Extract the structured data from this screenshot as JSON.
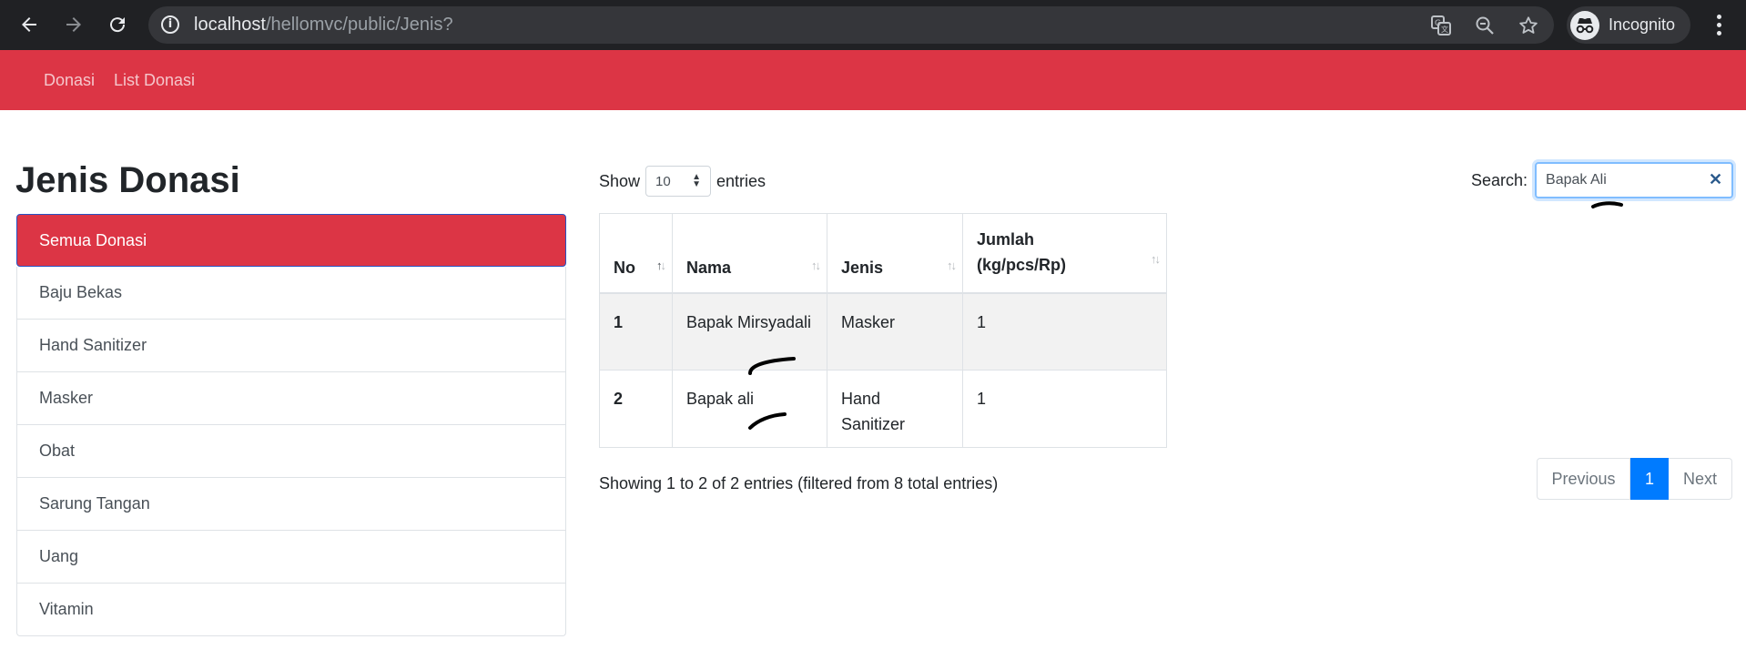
{
  "browser": {
    "url_host": "localhost",
    "url_path": "/hellomvc/public/Jenis?",
    "profile_label": "Incognito",
    "icons": [
      "back-arrow-icon",
      "forward-arrow-icon",
      "reload-icon",
      "info-icon",
      "translate-icon",
      "zoom-icon",
      "star-icon",
      "incognito-icon",
      "more-vert-icon"
    ]
  },
  "navbar": {
    "color": "#dc3545",
    "links": [
      "Donasi",
      "List Donasi"
    ]
  },
  "sidebar": {
    "title": "Jenis Donasi",
    "items": [
      {
        "label": "Semua Donasi",
        "active": true
      },
      {
        "label": "Baju Bekas",
        "active": false
      },
      {
        "label": "Hand Sanitizer",
        "active": false
      },
      {
        "label": "Masker",
        "active": false
      },
      {
        "label": "Obat",
        "active": false
      },
      {
        "label": "Sarung Tangan",
        "active": false
      },
      {
        "label": "Uang",
        "active": false
      },
      {
        "label": "Vitamin",
        "active": false
      }
    ]
  },
  "datatable": {
    "length_prefix": "Show",
    "length_value": "10",
    "length_suffix": "entries",
    "search_label": "Search:",
    "search_value": "Bapak Ali",
    "columns": [
      "No",
      "Nama",
      "Jenis",
      "Jumlah (kg/pcs/Rp)"
    ],
    "rows": [
      {
        "no": "1",
        "nama": "Bapak Mirsyadali",
        "jenis": "Masker",
        "jumlah": "1"
      },
      {
        "no": "2",
        "nama": "Bapak ali",
        "jenis": "Hand Sanitizer",
        "jumlah": "1"
      }
    ],
    "info": "Showing 1 to 2 of 2 entries (filtered from 8 total entries)",
    "pagination": {
      "previous": "Previous",
      "current": "1",
      "next": "Next"
    }
  }
}
